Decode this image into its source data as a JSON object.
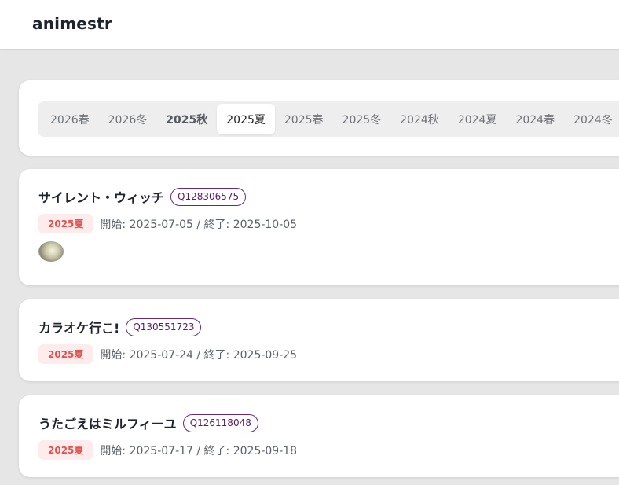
{
  "app": {
    "brand": "animestr"
  },
  "seasons": {
    "tabs": [
      {
        "label": "2026春"
      },
      {
        "label": "2026冬"
      },
      {
        "label": "2025秋"
      },
      {
        "label": "2025夏"
      },
      {
        "label": "2025春"
      },
      {
        "label": "2025冬"
      },
      {
        "label": "2024秋"
      },
      {
        "label": "2024夏"
      },
      {
        "label": "2024春"
      },
      {
        "label": "2024冬"
      }
    ],
    "selected": "2025夏",
    "emphasized": "2025秋"
  },
  "anime": [
    {
      "title": "サイレント・ウィッチ",
      "qid": "Q128306575",
      "season": "2025夏",
      "dates": "開始: 2025-07-05 / 終了: 2025-10-05",
      "has_thumbnail": true
    },
    {
      "title": "カラオケ行こ!",
      "qid": "Q130551723",
      "season": "2025夏",
      "dates": "開始: 2025-07-24 / 終了: 2025-09-25",
      "has_thumbnail": false
    },
    {
      "title": "うたごえはミルフィーユ",
      "qid": "Q126118048",
      "season": "2025夏",
      "dates": "開始: 2025-07-17 / 終了: 2025-09-18",
      "has_thumbnail": false
    }
  ],
  "colors": {
    "background": "#e6e6e6",
    "badge_text": "#e0534f",
    "badge_bg": "#fdeceb",
    "qid_border": "#6a2a7a"
  }
}
